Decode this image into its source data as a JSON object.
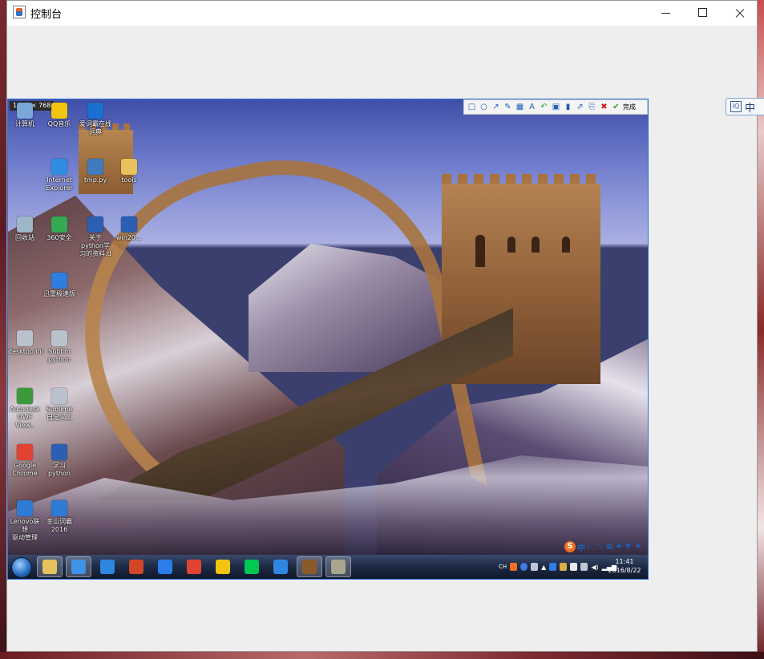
{
  "window": {
    "title": "控制台",
    "controls": {
      "minimize": "",
      "maximize": "",
      "close": ""
    }
  },
  "capture": {
    "size_label": "1366 × 768",
    "toolbar": {
      "tools": [
        "rectangle",
        "ellipse",
        "arrow",
        "pen",
        "mosaic",
        "text",
        "undo",
        "copy",
        "pin",
        "share",
        "save",
        "cancel",
        "confirm"
      ],
      "done_label": "完成"
    }
  },
  "desktop_icons": [
    {
      "label": "计算机",
      "icon": "computer-icon",
      "color": "#7aa7d8"
    },
    {
      "label": "QQ音乐",
      "icon": "qqmusic-icon",
      "color": "#f1c40f"
    },
    {
      "label": "爱词霸在线\n词典",
      "icon": "iciba-icon",
      "color": "#1b6fd1"
    },
    {
      "label": "Internet\nExplorer",
      "icon": "ie-icon",
      "color": "#2f8de4"
    },
    {
      "label": "tmp.py",
      "icon": "python-file-icon",
      "color": "#3f7bbd"
    },
    {
      "label": "tools",
      "icon": "folder-icon",
      "color": "#e8c25a"
    },
    {
      "label": "回收站",
      "icon": "recycle-bin-icon",
      "color": "#9fb6c9"
    },
    {
      "label": "360安全",
      "icon": "360-icon",
      "color": "#35a852"
    },
    {
      "label": "关于python学\n习的资料.d",
      "icon": "word-doc-icon",
      "color": "#2b5fb4"
    },
    {
      "label": "win20…",
      "icon": "word-doc-icon",
      "color": "#2b5fb4"
    },
    {
      "label": "迅雷极速版",
      "icon": "thunder-icon",
      "color": "#2d7ee0"
    },
    {
      "label": "desktop.ini",
      "icon": "ini-file-icon",
      "color": "#b9c2cc"
    },
    {
      "label": "Sublim\npython",
      "icon": "file-icon",
      "color": "#b9c2cc"
    },
    {
      "label": "Autodesk\nDWF View..",
      "icon": "autodesk-icon",
      "color": "#3c9a3c"
    },
    {
      "label": "Sublime\n自定义工",
      "icon": "file-icon",
      "color": "#b9c2cc"
    },
    {
      "label": "Google\nChrome",
      "icon": "chrome-icon",
      "color": "#e14333"
    },
    {
      "label": "学习\npython",
      "icon": "word-doc-icon",
      "color": "#2b5fb4"
    },
    {
      "label": "Lenovo联想\n驱动管理",
      "icon": "lenovo-icon",
      "color": "#2e7bd6"
    },
    {
      "label": "金山词霸\n2016",
      "icon": "kingsoft-icon",
      "color": "#2e7bd6"
    }
  ],
  "taskbar": {
    "apps": [
      {
        "name": "explorer",
        "icon": "folder-icon",
        "color": "#e6c35e",
        "active": true
      },
      {
        "name": "ie",
        "icon": "ie-icon",
        "color": "#3d93e6",
        "active": true
      },
      {
        "name": "bird",
        "icon": "bird-icon",
        "color": "#2f86e0",
        "active": false
      },
      {
        "name": "powerpoint",
        "icon": "powerpoint-icon",
        "color": "#d24726",
        "active": false
      },
      {
        "name": "browser",
        "icon": "browser-icon",
        "color": "#2b7de9",
        "active": false
      },
      {
        "name": "chrome",
        "icon": "chrome-icon",
        "color": "#e14333",
        "active": false
      },
      {
        "name": "qqmusic",
        "icon": "qqmusic-icon",
        "color": "#f1c40f",
        "active": false
      },
      {
        "name": "iqiyi",
        "icon": "iqiyi-icon",
        "color": "#00c853",
        "active": false
      },
      {
        "name": "contacts",
        "icon": "contacts-icon",
        "color": "#2f86e0",
        "active": false
      },
      {
        "name": "game",
        "icon": "game-icon",
        "color": "#8b5a2b",
        "active": true
      },
      {
        "name": "archive",
        "icon": "archive-icon",
        "color": "#a9a58f",
        "active": true
      }
    ],
    "tray_lang": "CH",
    "clock_time": "11:41",
    "clock_date": "2016/8/22"
  },
  "ime_bar": {
    "text": "中"
  },
  "side_ime": {
    "text": "中"
  }
}
